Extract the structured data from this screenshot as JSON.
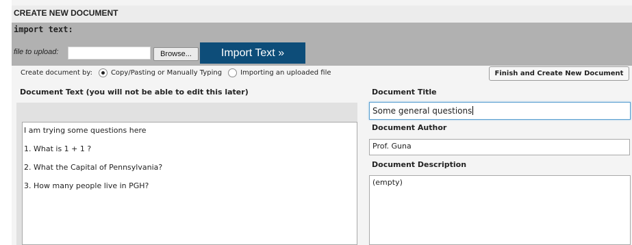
{
  "page": {
    "heading": "CREATE NEW DOCUMENT"
  },
  "import": {
    "title": "import text:",
    "file_label": "file to upload:",
    "file_value": "",
    "browse_label": "Browse...",
    "import_button_label": "Import Text »"
  },
  "create_by": {
    "label": "Create document by:",
    "options": [
      {
        "label": "Copy/Pasting or Manually Typing",
        "selected": true
      },
      {
        "label": "Importing an uploaded file",
        "selected": false
      }
    ]
  },
  "finish_button_label": "Finish and Create New Document",
  "document_text": {
    "label": "Document Text (you will not be able to edit this later)",
    "lines": [
      "I am trying some questions here",
      "1. What is 1 + 1 ?",
      "2. What the Capital of Pennsylvania?",
      "3. How many people live in PGH?"
    ]
  },
  "document_title": {
    "label": "Document Title",
    "value": "Some general questions"
  },
  "document_author": {
    "label": "Document Author",
    "value": "Prof. Guna"
  },
  "document_description": {
    "label": "Document Description",
    "value": "(empty)"
  },
  "colors": {
    "import_button_bg": "#0d4d79",
    "import_panel_bg": "#b1b1b1",
    "focus_border": "#5a9fd0"
  }
}
